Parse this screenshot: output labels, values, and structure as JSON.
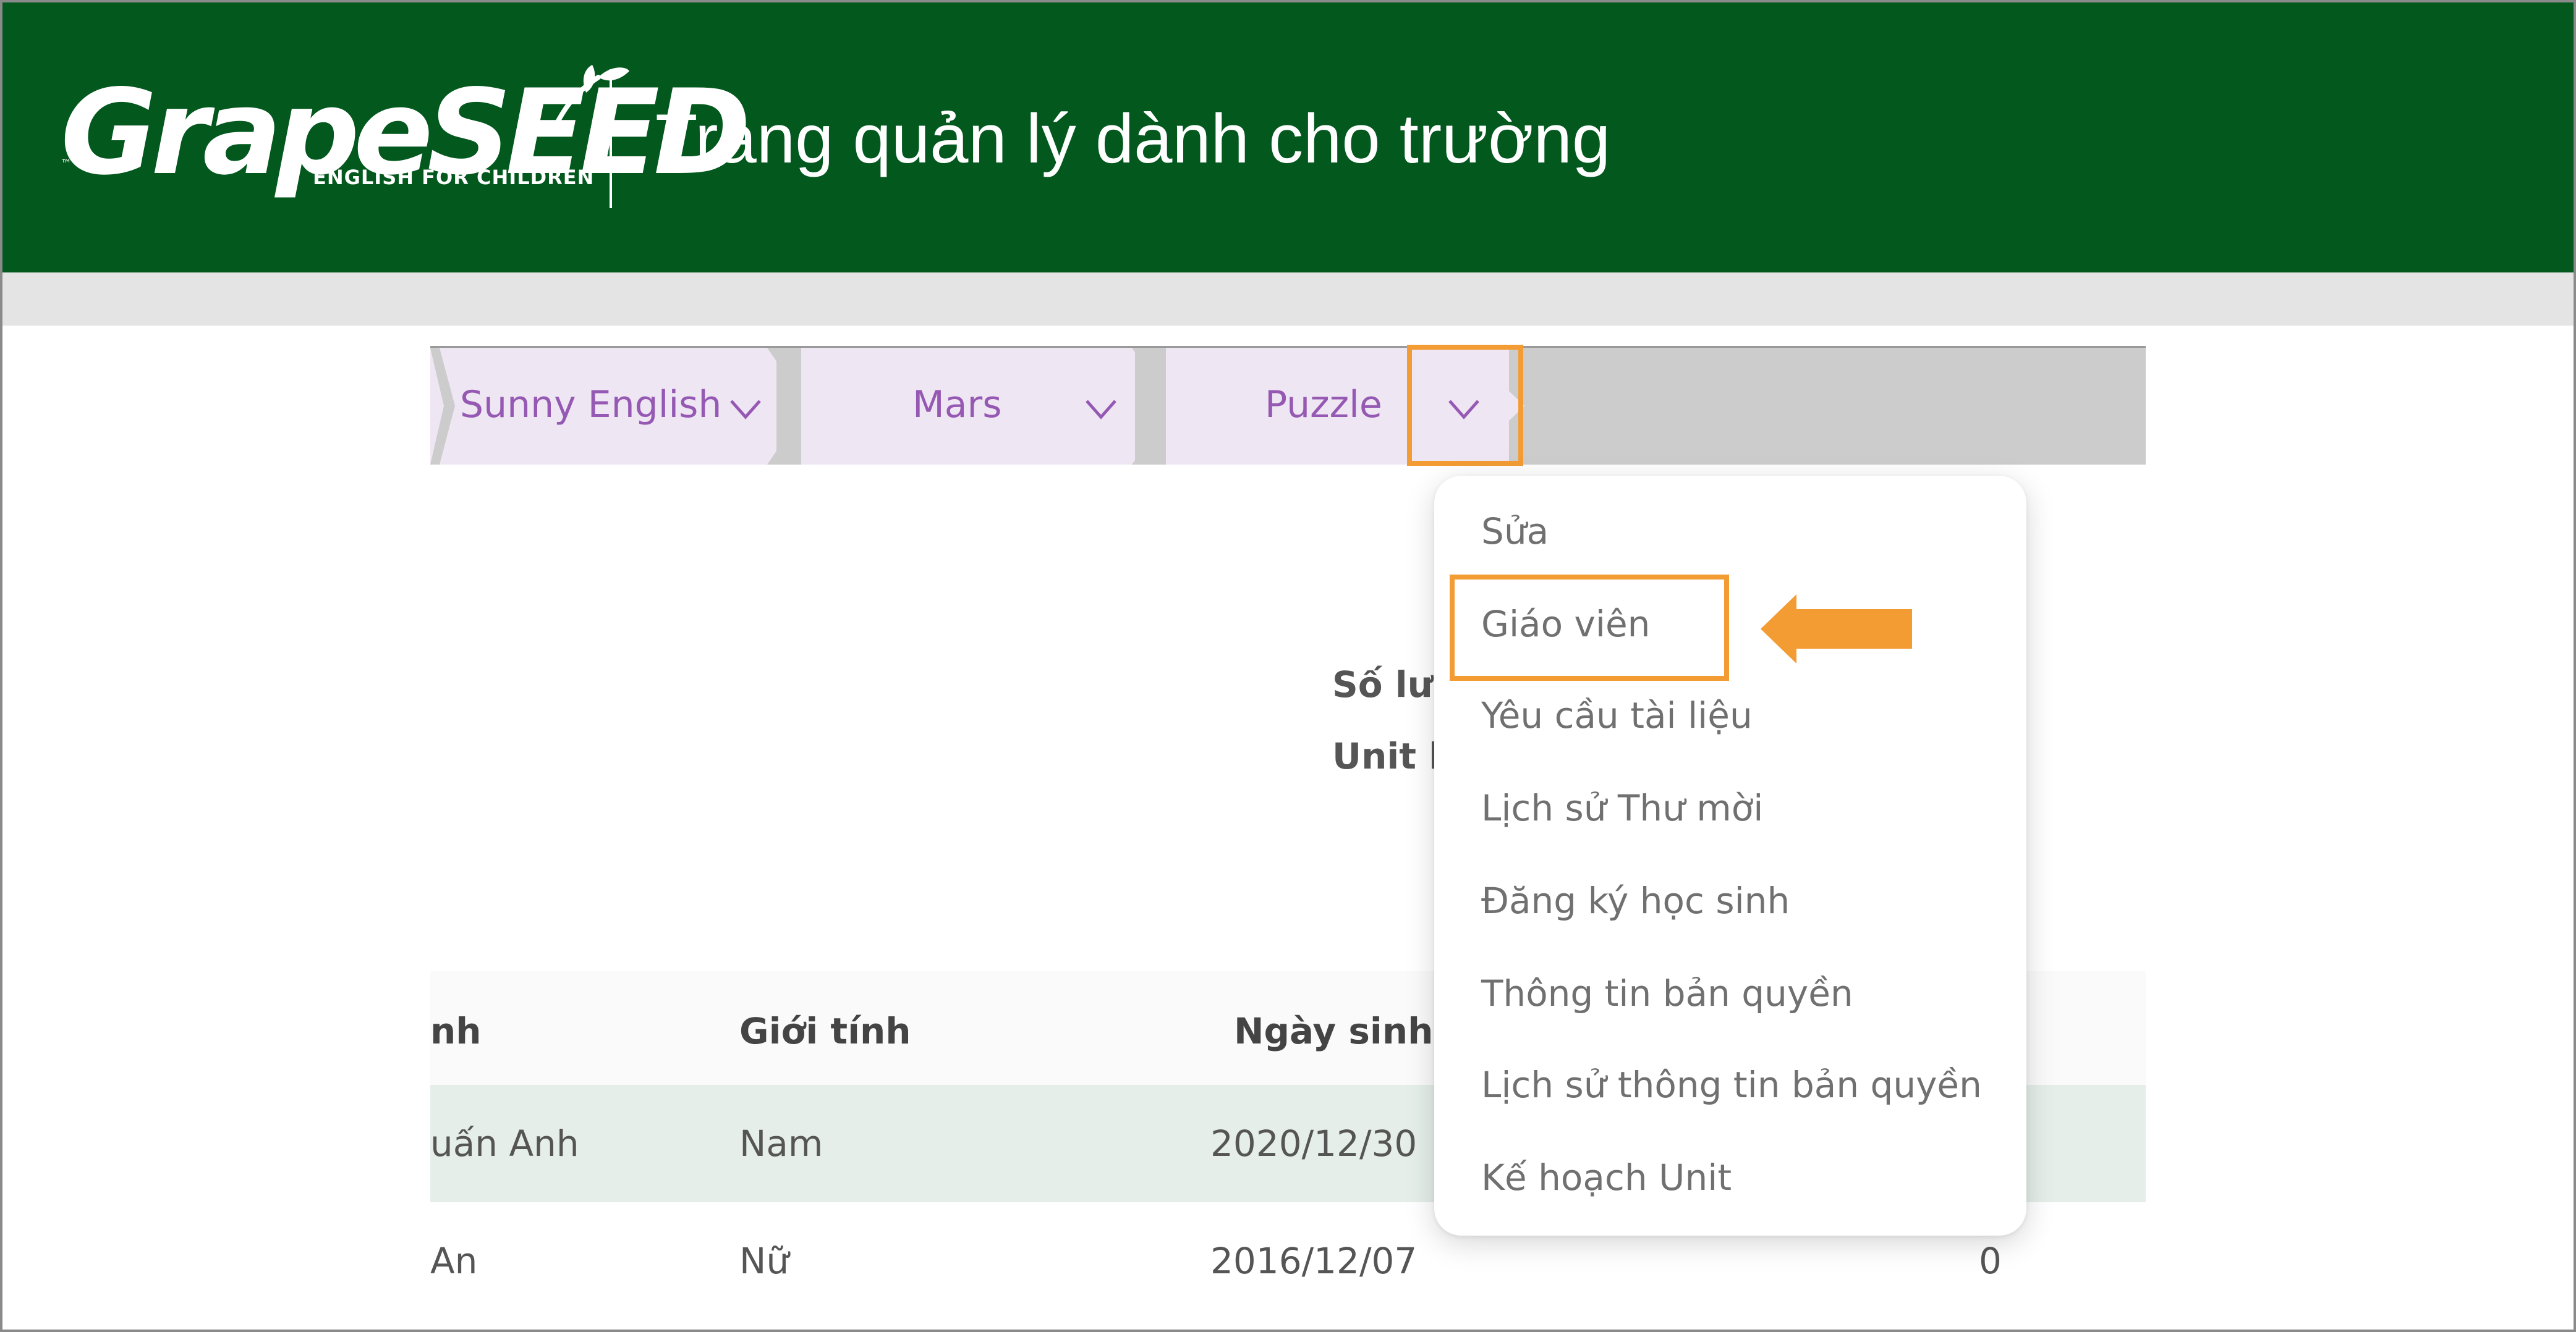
{
  "header": {
    "logo_text": "GrapeSEED",
    "logo_tagline": "ENGLISH FOR CHILDREN",
    "logo_tm": "™",
    "title": "Trang quản lý dành cho trường"
  },
  "breadcrumb": {
    "items": [
      {
        "label": "Sunny English"
      },
      {
        "label": "Mars"
      },
      {
        "label": "Puzzle"
      }
    ]
  },
  "meta": {
    "line1": "Số lượ",
    "line2": "Unit h"
  },
  "table": {
    "headers": [
      "nh",
      "Giới tính",
      "Ngày sinh"
    ],
    "rows": [
      {
        "name": "uấn Anh",
        "gender": "Nam",
        "dob": "2020/12/30",
        "extra": ""
      },
      {
        "name": "An",
        "gender": "Nữ",
        "dob": "2016/12/07",
        "extra": "0"
      }
    ]
  },
  "dropdown": {
    "items": [
      {
        "label": "Sửa"
      },
      {
        "label": "Giáo viên"
      },
      {
        "label": "Yêu cầu tài liệu"
      },
      {
        "label": "Lịch sử Thư mời"
      },
      {
        "label": "Đăng ký học sinh"
      },
      {
        "label": "Thông tin bản quyền"
      },
      {
        "label": "Lịch sử thông tin bản quyền"
      },
      {
        "label": "Kế hoạch Unit"
      }
    ]
  },
  "colors": {
    "header_bg": "#02581d",
    "highlight": "#f39c34",
    "breadcrumb_text": "#9559b3",
    "breadcrumb_bg": "#efe6f3",
    "row_highlight": "#e5eee8"
  },
  "icons": {
    "crumb_toggle": "chevron-down-icon",
    "annotation": "arrow-left-icon"
  }
}
